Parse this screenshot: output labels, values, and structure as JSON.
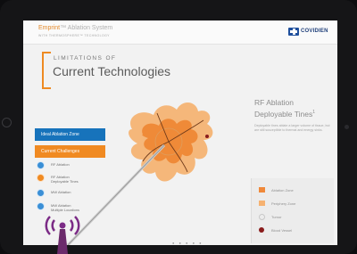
{
  "header": {
    "brand": "Emprint",
    "brand_suffix": "™ Ablation System",
    "subtitle": "WITH THERMOSPHERE™ TECHNOLOGY",
    "logo_text": "COVIDIEN"
  },
  "page": {
    "kicker": "LIMITATIONS OF",
    "title": "Current Technologies"
  },
  "info": {
    "title_line1": "RF Ablation",
    "title_line2": "Deployable Tines",
    "title_sup": "1",
    "description": "Deployable tines ablate a larger volume of tissue, but are still susceptible to thermal and energy sinks."
  },
  "sidebar": {
    "ideal_zone": "Ideal Ablation Zone",
    "current_challenges": "Current Challenges",
    "options": [
      {
        "label_line1": "RF Ablation",
        "label_line2": ""
      },
      {
        "label_line1": "RF Ablation",
        "label_line2": "Deployable Tines"
      },
      {
        "label_line1": "MW Ablation",
        "label_line2": ""
      },
      {
        "label_line1": "MW Ablation",
        "label_line2": "Multiple Locations"
      }
    ]
  },
  "legend": {
    "items": [
      {
        "label": "Ablation Zone",
        "color": "#f0893a"
      },
      {
        "label": "Periphery Zone",
        "color": "#f6b271"
      },
      {
        "label": "Tumor",
        "color": "#c8c8c8"
      },
      {
        "label": "Blood Vessel",
        "color": "#8a1c1c"
      }
    ]
  },
  "colors": {
    "accent_orange": "#f08a22",
    "accent_blue": "#1773bb"
  }
}
